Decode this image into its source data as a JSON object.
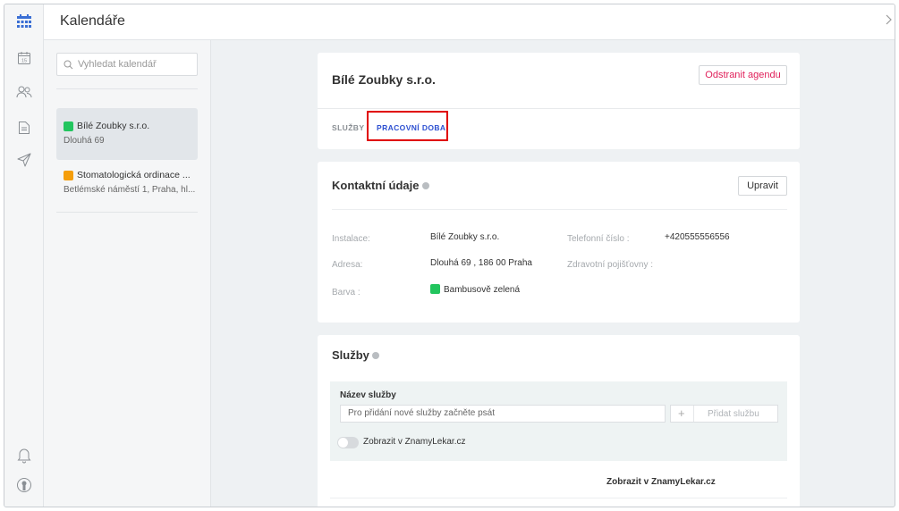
{
  "header": {
    "title": "Kalendáře"
  },
  "rail": {
    "icons": [
      "calendar-grid-icon",
      "calendar-day-icon",
      "users-icon",
      "document-icon",
      "send-icon",
      "bell-icon",
      "account-icon"
    ],
    "day_number": "15",
    "accent": "#3b6fd4"
  },
  "search": {
    "placeholder": "Vyhledat kalendář"
  },
  "calendars": [
    {
      "name": "Bílé Zoubky s.r.o.",
      "address": "Dlouhá 69",
      "color": "#22c55e"
    },
    {
      "name": "Stomatologická ordinace ...",
      "address": "Betlémské náměstí 1, Praha, hl...",
      "color": "#f59e0b"
    }
  ],
  "agenda": {
    "title": "Bílé Zoubky s.r.o.",
    "delete_label": "Odstranit agendu",
    "delete_color": "#e0205a",
    "tabs": [
      {
        "label": "SLUŽBY",
        "active": false
      },
      {
        "label": "PRACOVNÍ DOBA",
        "active": true
      }
    ],
    "highlight_color": "#e00000",
    "tab_active_color": "#2c4fd1"
  },
  "contact": {
    "title": "Kontaktní údaje",
    "edit_label": "Upravit",
    "rows": [
      {
        "label": "Instalace:",
        "value": "Bílé Zoubky s.r.o."
      },
      {
        "label": "Adresa:",
        "value": "Dlouhá 69 , 186 00 Praha"
      },
      {
        "label": "Barva :",
        "value": "Bambusově zelená"
      }
    ],
    "right_rows": [
      {
        "label": "Telefonní číslo :",
        "value": "+420555556556"
      },
      {
        "label": "Zdravotní pojišťovny :",
        "value": ""
      }
    ],
    "color_swatch": "#22c55e"
  },
  "services": {
    "title": "Služby",
    "field_label": "Název služby",
    "input_placeholder": "Pro přidání nové služby začněte psát",
    "add_label": "Přidat službu",
    "toggle_label": "Zobrazit v ZnamyLekar.cz",
    "toggle_on": false,
    "column_header": "Zobrazit v ZnamyLekar.cz"
  }
}
